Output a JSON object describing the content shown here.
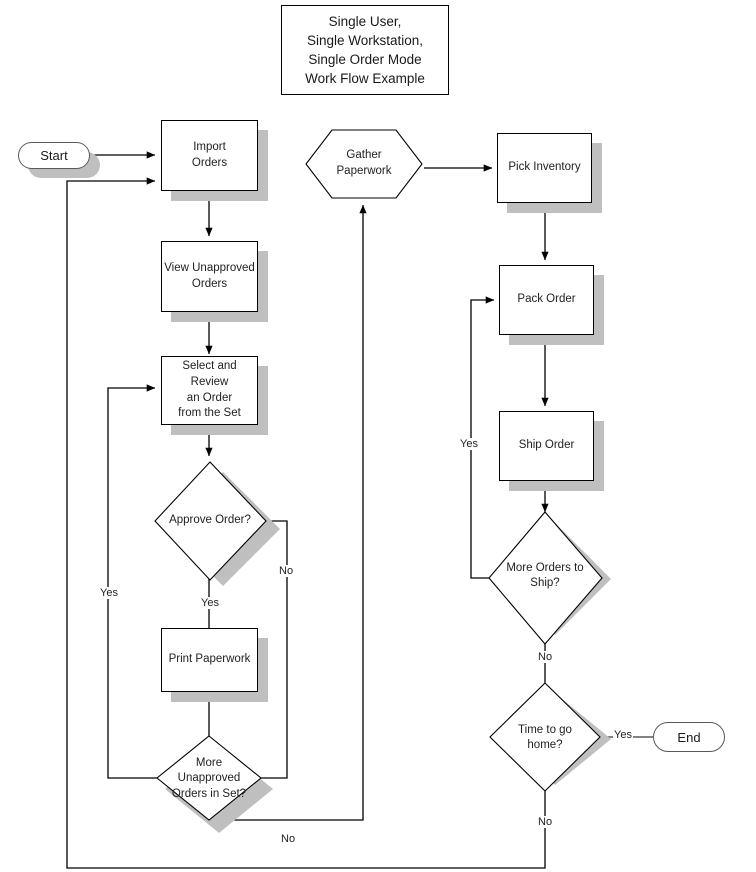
{
  "title": {
    "line1": "Single User,",
    "line2": "Single Workstation,",
    "line3": "Single Order Mode",
    "line4": "Work Flow Example"
  },
  "colors": {
    "stroke": "#000000",
    "shadow": "#bfbfbf",
    "terminator_stroke": "#595959",
    "background": "#ffffff",
    "text": "#222222"
  },
  "nodes": {
    "start": {
      "label": "Start",
      "shape": "terminator"
    },
    "import_orders": {
      "line1": "Import",
      "line2": "Orders",
      "shape": "process"
    },
    "view_unapproved": {
      "line1": "View Unapproved",
      "line2": "Orders",
      "shape": "process"
    },
    "select_review": {
      "line1": "Select and Review",
      "line2": "an Order",
      "line3": "from the Set",
      "shape": "process"
    },
    "approve_order": {
      "label": "Approve Order?",
      "shape": "decision"
    },
    "print_paperwork": {
      "label": "Print Paperwork",
      "shape": "process"
    },
    "more_unapproved": {
      "line1": "More",
      "line2": "Unapproved",
      "line3": "Orders in Set?",
      "shape": "decision"
    },
    "gather_paperwork": {
      "line1": "Gather",
      "line2": "Paperwork",
      "shape": "hexagon"
    },
    "pick_inventory": {
      "label": "Pick Inventory",
      "shape": "process"
    },
    "pack_order": {
      "label": "Pack Order",
      "shape": "process"
    },
    "ship_order": {
      "label": "Ship Order",
      "shape": "process"
    },
    "more_orders_ship": {
      "line1": "More Orders to",
      "line2": "Ship?",
      "shape": "decision"
    },
    "time_to_go_home": {
      "line1": "Time to go",
      "line2": "home?",
      "shape": "decision"
    },
    "end": {
      "label": "End",
      "shape": "terminator"
    }
  },
  "edge_labels": {
    "approve_yes": "Yes",
    "approve_no": "No",
    "select_loop_yes": "Yes",
    "more_unapproved_no": "No",
    "more_orders_ship_yes": "Yes",
    "more_orders_ship_no": "No",
    "time_home_yes": "Yes",
    "time_home_no": "No"
  }
}
